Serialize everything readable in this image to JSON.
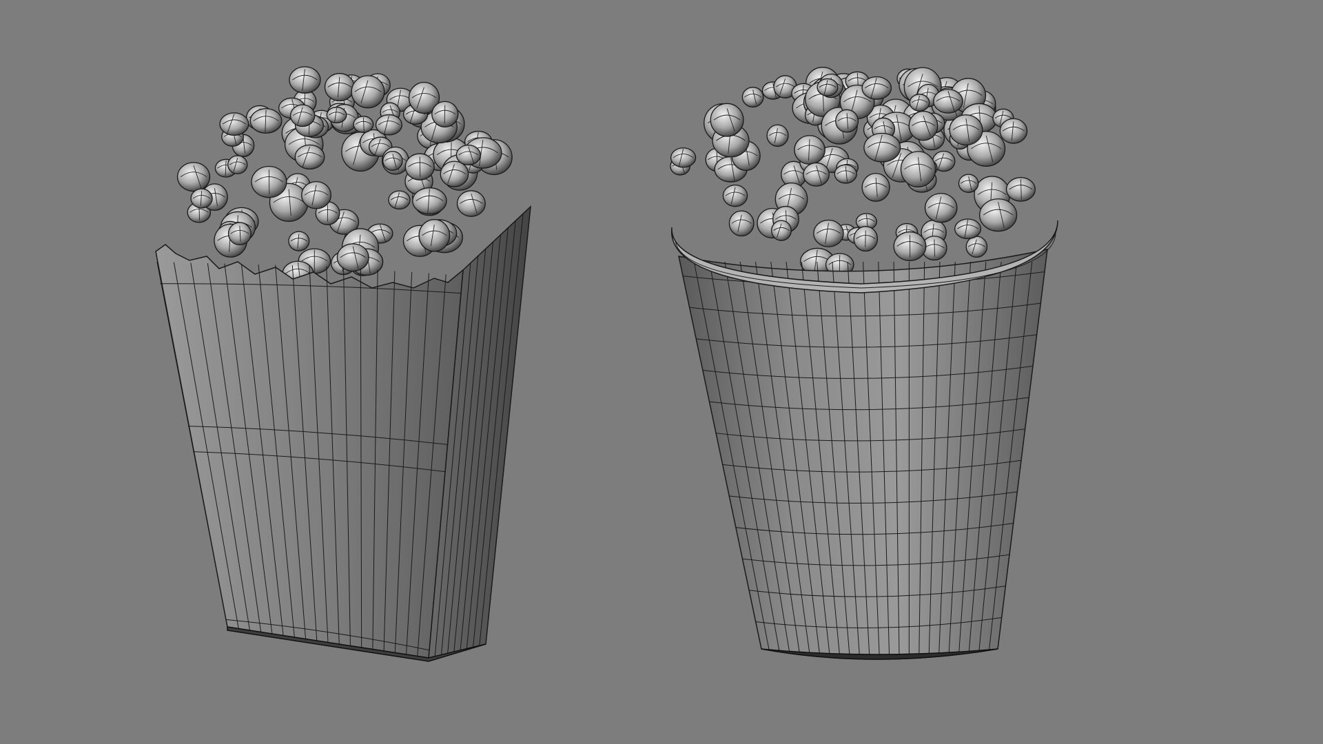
{
  "viewport": {
    "background_color": "#7d7d7d",
    "shading_mode": "smooth-shaded-with-wireframe-edges"
  },
  "models": [
    {
      "name": "popcorn-box-square",
      "container_shape": "tapered-square-box-with-zigzag-rim",
      "fill": "popcorn-kernels",
      "surface_color": "#8c8c8c",
      "wire_color": "#1a1a1a"
    },
    {
      "name": "popcorn-bucket-round",
      "container_shape": "tapered-cylindrical-cup-with-rolled-rim",
      "fill": "popcorn-kernels",
      "surface_color": "#8c8c8c",
      "wire_color": "#1a1a1a"
    }
  ]
}
